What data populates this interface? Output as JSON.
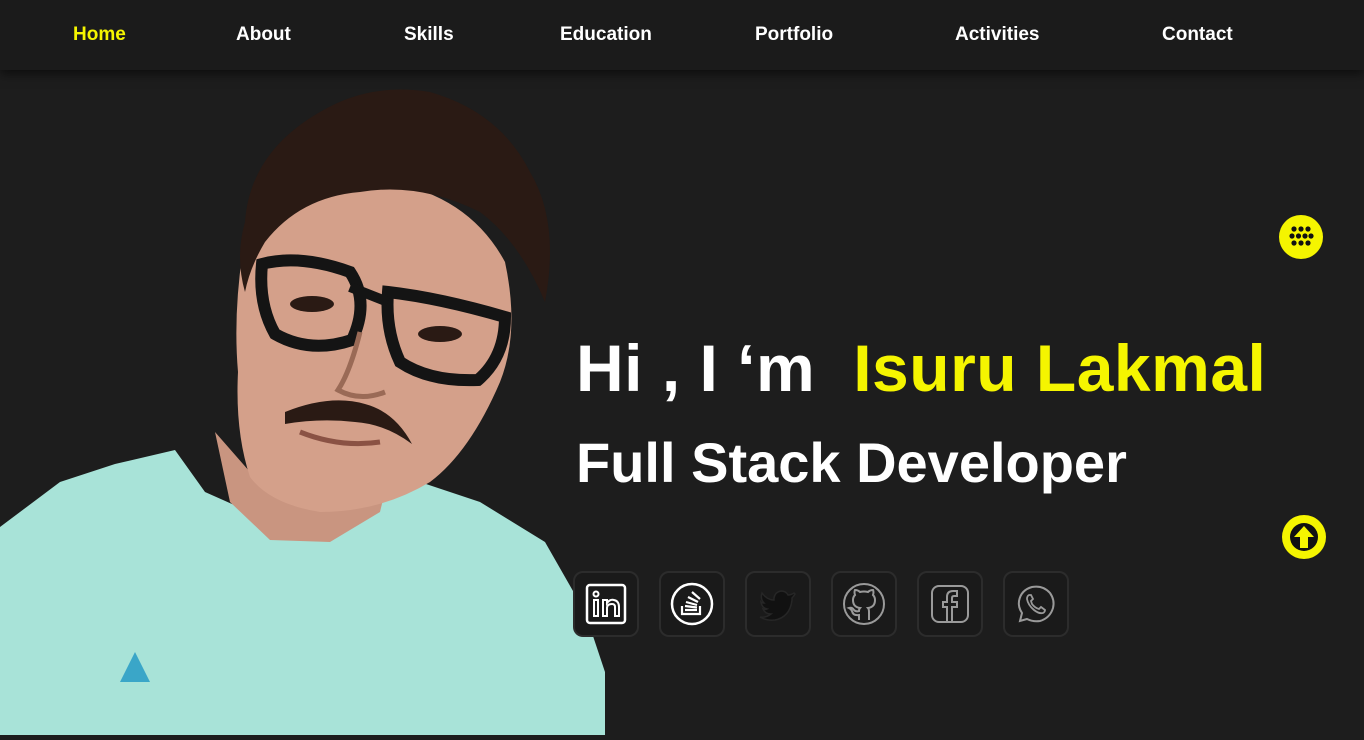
{
  "nav": {
    "items": [
      {
        "label": "Home",
        "active": true
      },
      {
        "label": "About",
        "active": false
      },
      {
        "label": "Skills",
        "active": false
      },
      {
        "label": "Education",
        "active": false
      },
      {
        "label": "Portfolio",
        "active": false
      },
      {
        "label": "Activities",
        "active": false
      },
      {
        "label": "Contact",
        "active": false
      }
    ]
  },
  "hero": {
    "greeting": "Hi ,  I ‘m",
    "name": "Isuru Lakmal",
    "role": "Full Stack Developer"
  },
  "social": [
    {
      "name": "linkedin-icon",
      "style": "white"
    },
    {
      "name": "stackoverflow-icon",
      "style": "white"
    },
    {
      "name": "twitter-icon",
      "style": "dark"
    },
    {
      "name": "github-icon",
      "style": "grey"
    },
    {
      "name": "facebook-icon",
      "style": "grey"
    },
    {
      "name": "whatsapp-icon",
      "style": "grey"
    }
  ],
  "fabs": {
    "menu_icon": "grid-dots-icon",
    "scroll_icon": "arrow-up-icon"
  },
  "colors": {
    "background": "#1d1d1d",
    "accent": "#f5f500",
    "text": "#ffffff"
  }
}
